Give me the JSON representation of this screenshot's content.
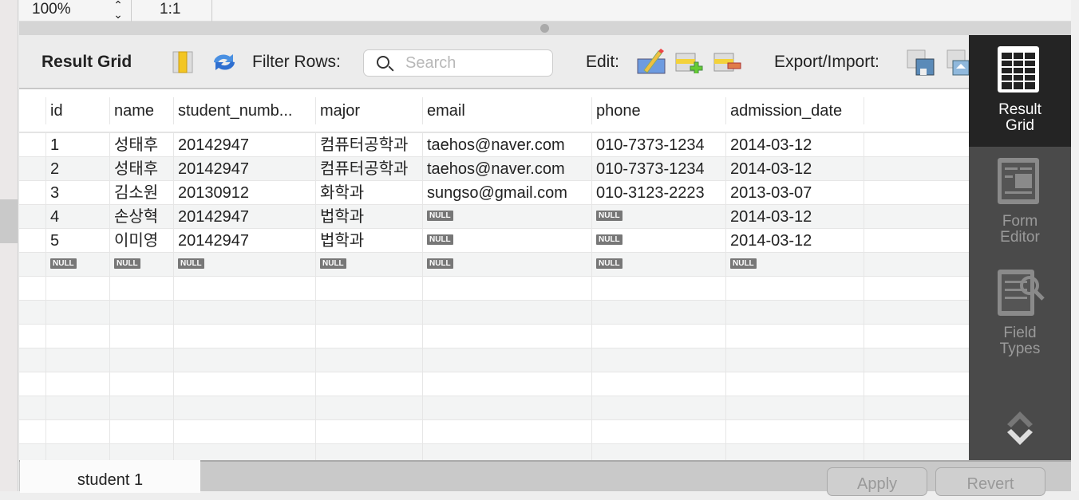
{
  "topbar": {
    "zoom": "100%",
    "ratio": "1:1"
  },
  "toolbar": {
    "title": "Result Grid",
    "filter_label": "Filter Rows:",
    "search_placeholder": "Search",
    "edit_label": "Edit:",
    "export_label": "Export/Import:"
  },
  "columns": [
    "id",
    "name",
    "student_numb...",
    "major",
    "email",
    "phone",
    "admission_date"
  ],
  "rows": [
    [
      "1",
      "성태후",
      "20142947",
      "컴퓨터공학과",
      "taehos@naver.com",
      "010-7373-1234",
      "2014-03-12"
    ],
    [
      "2",
      "성태후",
      "20142947",
      "컴퓨터공학과",
      "taehos@naver.com",
      "010-7373-1234",
      "2014-03-12"
    ],
    [
      "3",
      "김소원",
      "20130912",
      "화학과",
      "sungso@gmail.com",
      "010-3123-2223",
      "2013-03-07"
    ],
    [
      "4",
      "손상혁",
      "20142947",
      "법학과",
      null,
      null,
      "2014-03-12"
    ],
    [
      "5",
      "이미영",
      "20142947",
      "법학과",
      null,
      null,
      "2014-03-12"
    ],
    [
      null,
      null,
      null,
      null,
      null,
      null,
      null
    ]
  ],
  "null_label": "NULL",
  "sidebar": [
    {
      "label": "Result\nGrid",
      "active": true
    },
    {
      "label": "Form\nEditor"
    },
    {
      "label": "Field\nTypes"
    }
  ],
  "bottom": {
    "tab": "student 1",
    "apply": "Apply",
    "revert": "Revert"
  }
}
